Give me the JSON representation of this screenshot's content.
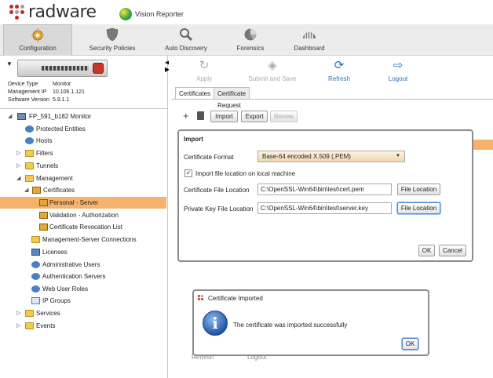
{
  "header": {
    "brand": "radware",
    "product": "Vision Reporter"
  },
  "nav": {
    "tabs": [
      {
        "label": "Configuration",
        "icon": "gear-icon"
      },
      {
        "label": "Security Policies",
        "icon": "shield-icon"
      },
      {
        "label": "Auto Discovery",
        "icon": "magnifier-icon"
      },
      {
        "label": "Forensics",
        "icon": "pie-chart-icon"
      },
      {
        "label": "Dashboard",
        "icon": "dashboard-icon"
      }
    ]
  },
  "device": {
    "info": [
      {
        "key": "Device Type",
        "value": "Monitor"
      },
      {
        "key": "Management IP",
        "value": "10.106.1.121"
      },
      {
        "key": "Software Version",
        "value": "5.9.1.1"
      }
    ]
  },
  "tree": {
    "items": [
      {
        "label": "FP_591_b182 Monitor"
      },
      {
        "label": "Protected Entities"
      },
      {
        "label": "Hosts"
      },
      {
        "label": "Filters"
      },
      {
        "label": "Tunnels"
      },
      {
        "label": "Management"
      },
      {
        "label": "Certificates"
      },
      {
        "label": "Personal - Server"
      },
      {
        "label": "Validation - Authorization"
      },
      {
        "label": "Certificate Revocation List"
      },
      {
        "label": "Management-Server Connections"
      },
      {
        "label": "Licenses"
      },
      {
        "label": "Administrative Users"
      },
      {
        "label": "Authentication Servers"
      },
      {
        "label": "Web User Roles"
      },
      {
        "label": "IP Groups"
      },
      {
        "label": "Services"
      },
      {
        "label": "Events"
      }
    ]
  },
  "toolbar": {
    "apply": "Apply",
    "submit_save": "Submit and Save",
    "refresh": "Refresh",
    "logout": "Logout"
  },
  "subtabs": {
    "certificates": "Certificates",
    "certificate_request": "Certificate Request"
  },
  "actions": {
    "add": "+",
    "import": "Import",
    "export": "Export",
    "renew": "Renew"
  },
  "import_dialog": {
    "title": "Import",
    "format_label": "Certificate Format",
    "format_value": "Base-64 encoded X.509 (.PEM)",
    "checkbox_label": "Import file location on local machine",
    "checkbox_mark": "✓",
    "cert_label": "Certificate File Location",
    "cert_value": "C:\\OpenSSL-Win64\\bin\\test\\cert.pem",
    "key_label": "Private Key File Location",
    "key_value": "C:\\OpenSSL-Win64\\bin\\test\\server.key",
    "file_location_button": "File Location",
    "ok": "OK",
    "cancel": "Cancel"
  },
  "imported_dialog": {
    "title": "Certificate Imported",
    "message": "The certificate was imported successfully",
    "ok": "OK",
    "icon_glyph": "i"
  },
  "background_ghost": {
    "refresh": "Refresh",
    "logout": "Logout"
  }
}
